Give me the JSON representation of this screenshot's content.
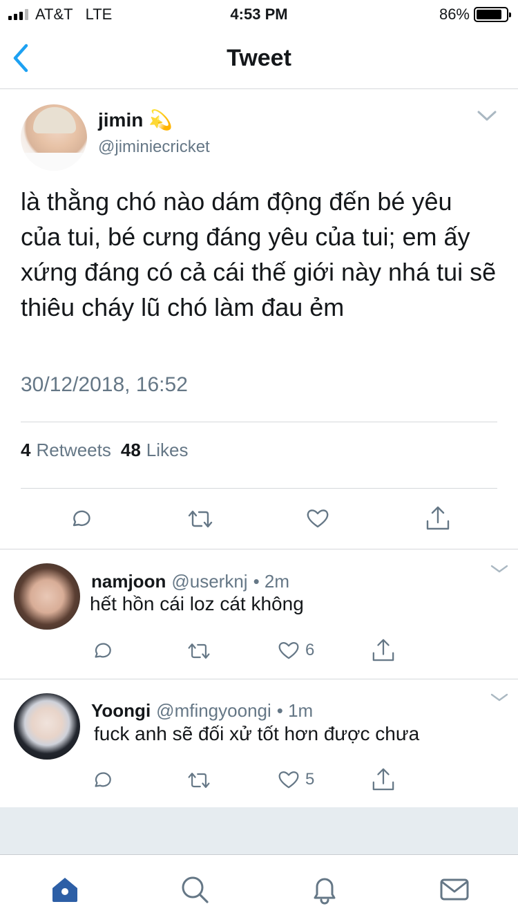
{
  "status_bar": {
    "carrier": "AT&T",
    "network": "LTE",
    "time": "4:53 PM",
    "battery_percent": "86%",
    "battery_level": 0.86
  },
  "nav": {
    "title": "Tweet",
    "back_icon": "chevron-left-icon"
  },
  "main_tweet": {
    "author_name": "jimin",
    "name_emoji": "💫",
    "handle": "@jiminiecricket",
    "text": "là thằng chó nào dám động đến bé yêu của tui, bé cưng đáng yêu của tui; em ấy xứng đáng có cả cái thế giới này nhá tui sẽ thiêu cháy lũ chó làm đau ẻm",
    "timestamp": "30/12/2018, 16:52",
    "retweet_count": "4",
    "retweet_label": "Retweets",
    "like_count": "48",
    "like_label": "Likes"
  },
  "replies": [
    {
      "name": "namjoon",
      "handle": "@userknj",
      "time": "• 2m",
      "text": "hết hồn cái loz cát không",
      "like_count": "6"
    },
    {
      "name": "Yoongi",
      "handle": "@mfingyoongi",
      "time": "• 1m",
      "text": "fuck anh sẽ đối xử tốt hơn được chưa",
      "like_count": "5"
    }
  ],
  "tab_bar": {
    "items": [
      "home-icon",
      "search-icon",
      "notifications-icon",
      "messages-icon"
    ],
    "active": "home-icon"
  },
  "colors": {
    "accent": "#1da1f2",
    "home_active": "#2d5fa6",
    "secondary_text": "#657786",
    "divider": "#d5d8db"
  }
}
